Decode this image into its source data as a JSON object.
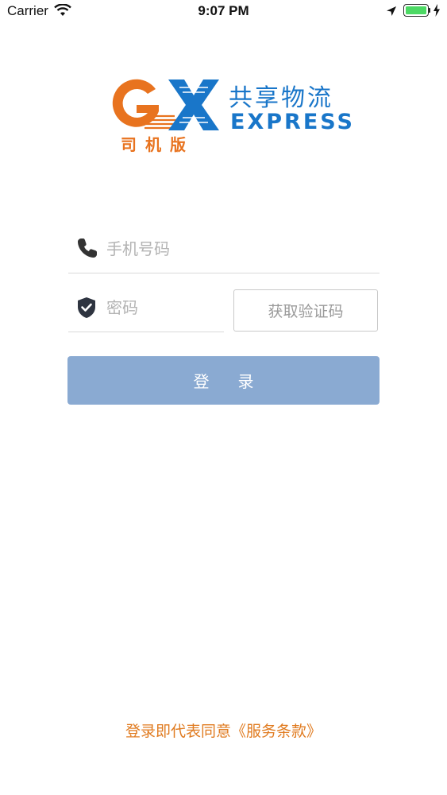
{
  "status_bar": {
    "carrier": "Carrier",
    "time": "9:07 PM",
    "battery_level": 1.0,
    "battery_color": "#4cd964",
    "icons": [
      "wifi-icon",
      "location-arrow-icon",
      "battery-icon",
      "charging-bolt-icon"
    ]
  },
  "logo": {
    "mark": "GX",
    "sub_label": "司机版",
    "cn_name": "共享物流",
    "en_name": "EXPRESS",
    "colors": {
      "orange": "#e8731f",
      "blue": "#1976c9"
    }
  },
  "form": {
    "phone": {
      "icon": "phone-icon",
      "placeholder": "手机号码",
      "value": ""
    },
    "code": {
      "icon": "shield-check-icon",
      "placeholder": "密码",
      "value": ""
    },
    "get_code_label": "获取验证码",
    "login_label": "登录",
    "login_color": "#8aaad2"
  },
  "footer": {
    "terms_text": "登录即代表同意《服务条款》",
    "terms_color": "#e07b20"
  }
}
